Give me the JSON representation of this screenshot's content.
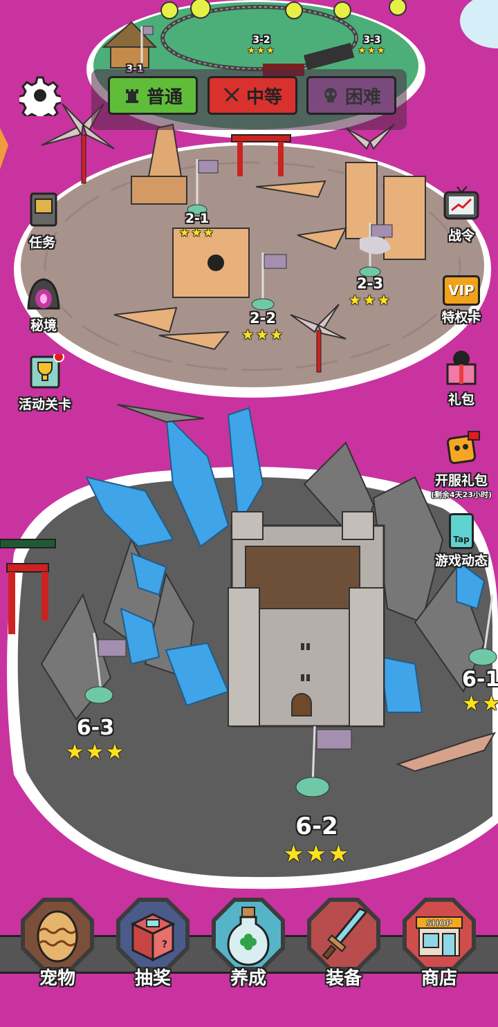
{
  "difficulty": {
    "normal": "普通",
    "medium": "中等",
    "hard": "困难"
  },
  "side_left": {
    "tasks": "任务",
    "secret_realm": "秘境",
    "event_levels": "活动关卡"
  },
  "side_right": {
    "battle_pass": "战令",
    "vip_badge": "VIP",
    "privilege_card": "特权卡",
    "gift_pack": "礼包",
    "server_gift": "开服礼包",
    "server_gift_timer": "(剩余4天23小时)",
    "tap_badge": "Tap",
    "game_news": "游戏动态"
  },
  "levels": {
    "l31": {
      "num": "3-1",
      "stars": "★★★"
    },
    "l32": {
      "num": "3-2",
      "stars": "★★★"
    },
    "l33": {
      "num": "3-3",
      "stars": "★★★"
    },
    "l21": {
      "num": "2-1",
      "stars": "★★★"
    },
    "l22": {
      "num": "2-2",
      "stars": "★★★"
    },
    "l23": {
      "num": "2-3",
      "stars": "★★★"
    },
    "l61": {
      "num": "6-1",
      "stars": "★★★"
    },
    "l62": {
      "num": "6-2",
      "stars": "★★★"
    },
    "l63": {
      "num": "6-3",
      "stars": "★★★"
    }
  },
  "bottom_nav": [
    {
      "label": "宠物",
      "icon": "egg-icon"
    },
    {
      "label": "抽奖",
      "icon": "lottery-box-icon"
    },
    {
      "label": "养成",
      "icon": "clover-bottle-icon"
    },
    {
      "label": "装备",
      "icon": "sword-icon"
    },
    {
      "label": "商店",
      "icon": "shop-icon"
    }
  ],
  "shop_sign": "SHOP",
  "colors": {
    "background": "#c9339f",
    "normal_tab": "#5fbd3a",
    "medium_tab": "#d9312d",
    "hard_tab": "#7a4a7d",
    "star": "#ffe11a"
  }
}
